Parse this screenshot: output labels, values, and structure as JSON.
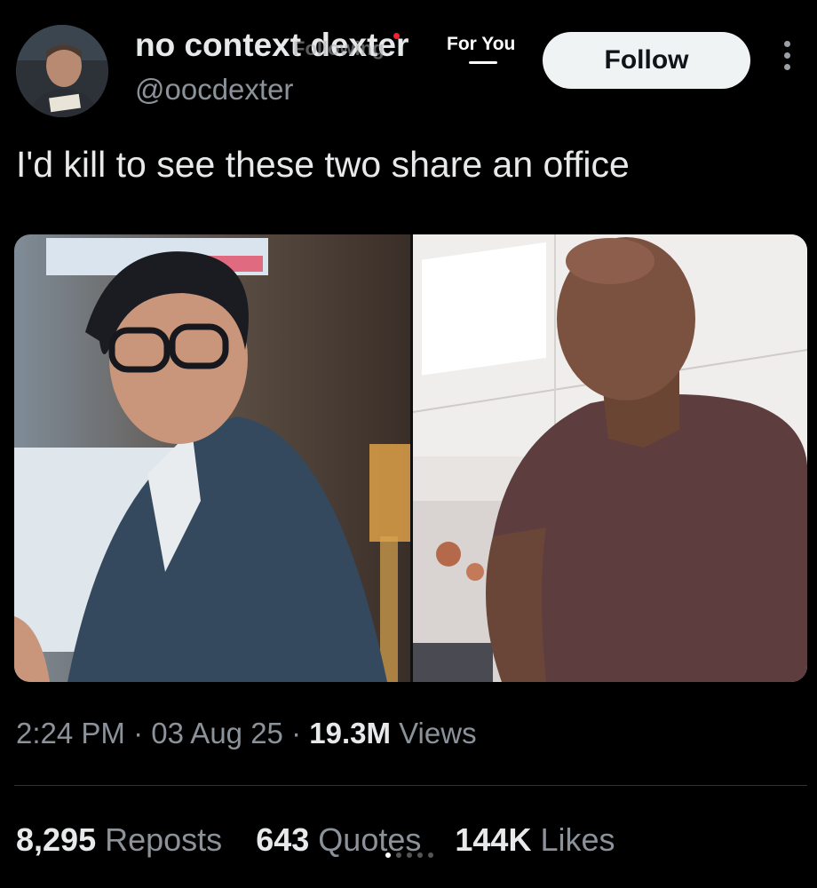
{
  "profile": {
    "display_name": "no context dexter",
    "handle": "@oocdexter"
  },
  "timeline_tabs": {
    "following_label": "Following",
    "for_you_label": "For You",
    "active": "For You"
  },
  "follow_button": {
    "label": "Follow"
  },
  "tweet": {
    "text": "I'd kill to see these two share an office",
    "media": [
      {
        "icon": "photo"
      },
      {
        "icon": "photo"
      }
    ]
  },
  "meta": {
    "time": "2:24 PM",
    "separator": "·",
    "date": "03 Aug 25",
    "views_count": "19.3M",
    "views_label": "Views"
  },
  "stats": {
    "reposts_count": "8,295",
    "reposts_label": "Reposts",
    "quotes_count": "643",
    "quotes_label": "Quotes",
    "likes_count": "144K",
    "likes_label": "Likes"
  },
  "icons": [
    "more-options-icon",
    "notification-dot-icon"
  ],
  "colors": {
    "background": "#000000",
    "text_primary": "#e7e9ea",
    "text_secondary": "#8b9299",
    "follow_button_bg": "#eff3f4",
    "notification_dot": "#f4212e"
  }
}
